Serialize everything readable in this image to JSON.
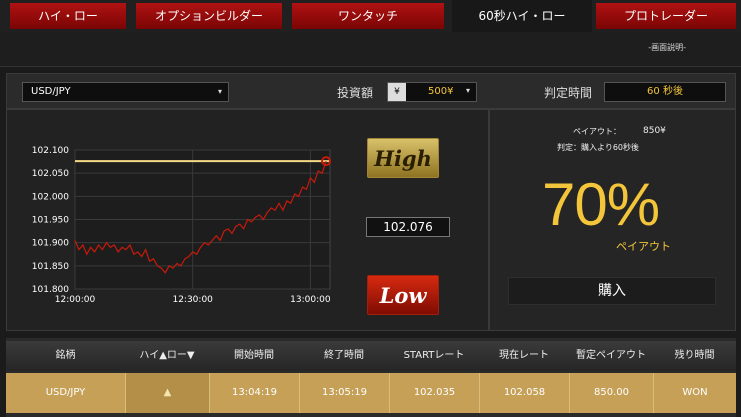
{
  "tabs": [
    {
      "label": "ハイ・ロー",
      "active": false
    },
    {
      "label": "オプションビルダー",
      "active": false
    },
    {
      "label": "ワンタッチ",
      "active": false
    },
    {
      "label": "60秒ハイ・ロー",
      "active": true
    },
    {
      "label": "プロトレーダー",
      "active": false
    }
  ],
  "help_link": "-画面説明-",
  "controls": {
    "pair": "USD/JPY",
    "investment_label": "投資額",
    "currency_symbol": "¥",
    "amount": "500¥",
    "expiry_label": "判定時間",
    "expiry_value": "60 秒後"
  },
  "chart_data": {
    "type": "line",
    "x_ticks": [
      "12:00:00",
      "12:30:00",
      "13:00:00"
    ],
    "y_ticks": [
      "102.100",
      "102.050",
      "102.000",
      "101.950",
      "101.900",
      "101.850",
      "101.800"
    ],
    "ylim": [
      101.8,
      102.1
    ],
    "xlim": [
      0,
      65
    ],
    "grid": true,
    "reference_level": 102.076,
    "series": [
      {
        "x": [
          0,
          1,
          2,
          3,
          4,
          5,
          6,
          7,
          8,
          9,
          10,
          11,
          12,
          13,
          14,
          15,
          16,
          17,
          18,
          19,
          20,
          21,
          22,
          23,
          24,
          25,
          26,
          27,
          28,
          29,
          30,
          31,
          32,
          33,
          34,
          35,
          36,
          37,
          38,
          39,
          40,
          41,
          42,
          43,
          44,
          45,
          46,
          47,
          48,
          49,
          50,
          51,
          52,
          53,
          54,
          55,
          56,
          57,
          58,
          59,
          60,
          61,
          62,
          63,
          64
        ],
        "values": [
          101.905,
          101.885,
          101.895,
          101.875,
          101.89,
          101.88,
          101.895,
          101.885,
          101.9,
          101.89,
          101.895,
          101.88,
          101.89,
          101.885,
          101.895,
          101.875,
          101.88,
          101.87,
          101.885,
          101.86,
          101.865,
          101.85,
          101.845,
          101.835,
          101.85,
          101.845,
          101.855,
          101.85,
          101.865,
          101.87,
          101.88,
          101.875,
          101.89,
          101.9,
          101.895,
          101.905,
          101.915,
          101.905,
          101.925,
          101.93,
          101.92,
          101.935,
          101.94,
          101.93,
          101.95,
          101.945,
          101.955,
          101.96,
          101.95,
          101.965,
          101.975,
          101.97,
          101.985,
          101.97,
          101.99,
          101.985,
          102.005,
          102.0,
          102.02,
          102.015,
          102.04,
          102.03,
          102.055,
          102.05,
          102.076
        ]
      }
    ]
  },
  "buttons": {
    "high": "High",
    "low": "Low",
    "buy": "購入"
  },
  "current_rate": "102.076",
  "payout": {
    "payout_label": "ペイアウト：",
    "payout_amount": "850¥",
    "judge_text": "判定：購入より60秒後",
    "percent": "70%",
    "percent_caption": "ペイアウト"
  },
  "table": {
    "headers": [
      "銘柄",
      "ハイ▲ロー▼",
      "開始時間",
      "終了時間",
      "STARTレート",
      "現在レート",
      "暫定ペイアウト",
      "残り時間"
    ],
    "rows": [
      [
        "USD/JPY",
        "▲",
        "13:04:19",
        "13:05:19",
        "102.035",
        "102.058",
        "850.00",
        "WON"
      ]
    ]
  },
  "colors": {
    "accent_gold": "#f3c53a",
    "tab_red": "#b01212",
    "row_gold": "#c6a057"
  }
}
